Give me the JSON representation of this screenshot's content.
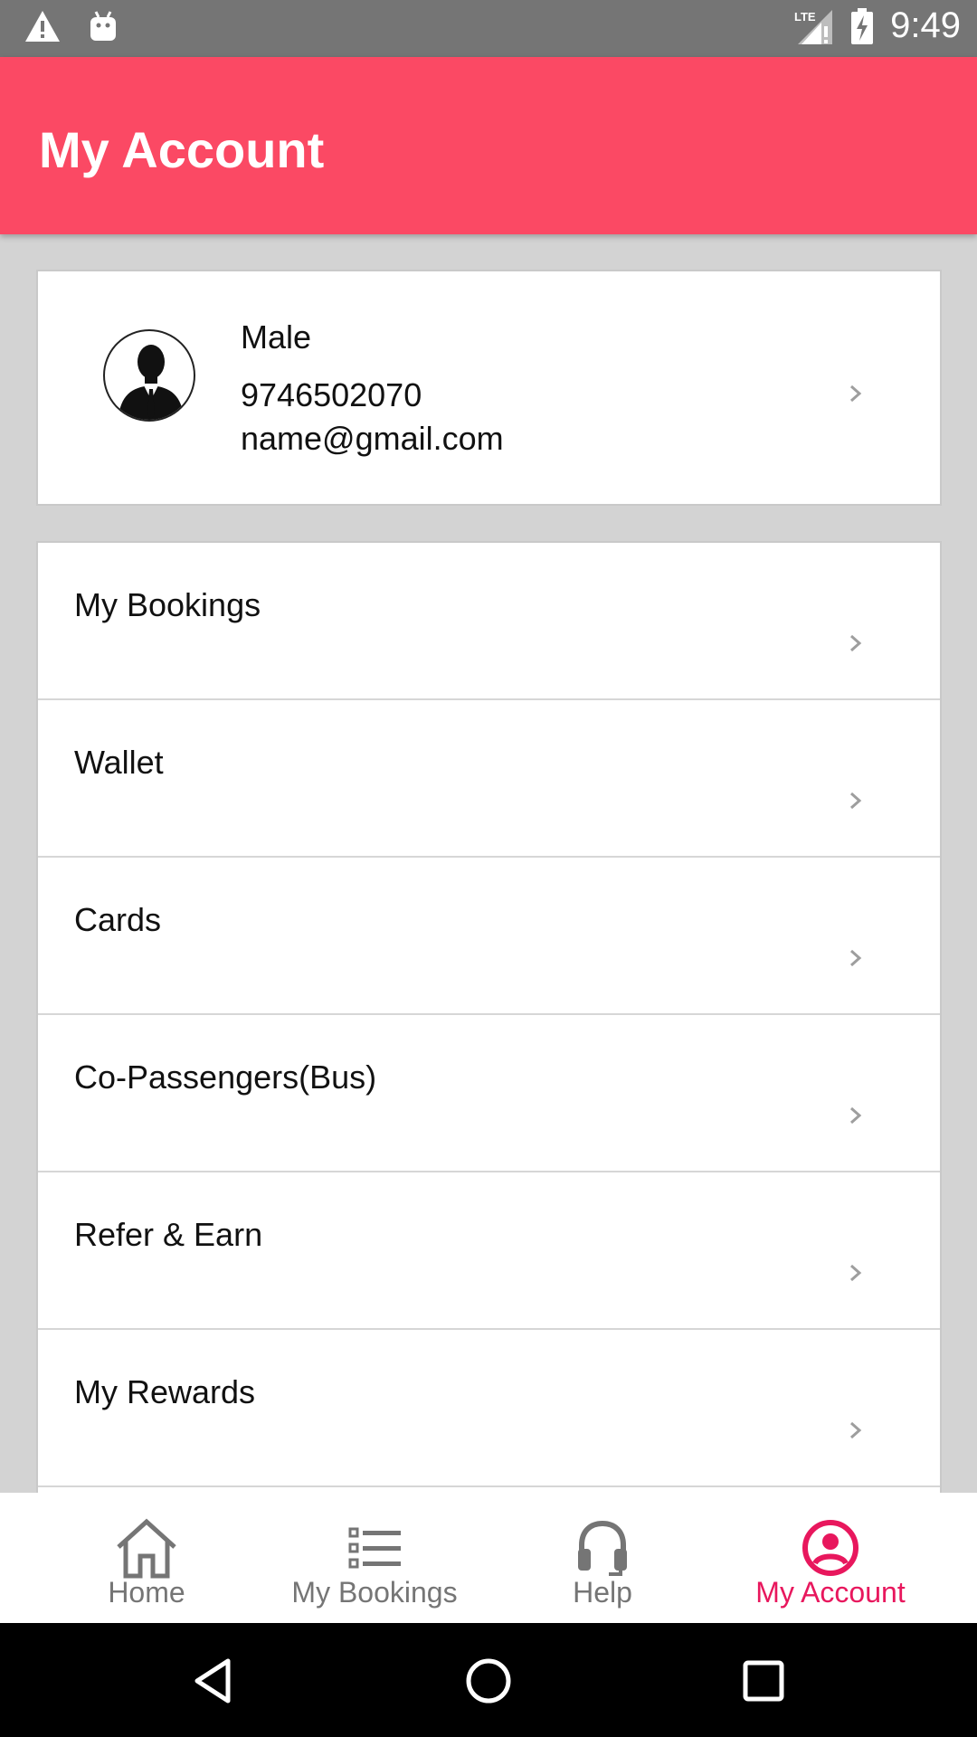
{
  "status_bar": {
    "time": "9:49",
    "icons": [
      "warning-icon",
      "android-icon",
      "lte-signal-icon",
      "battery-charging-icon"
    ]
  },
  "header": {
    "title": "My Account"
  },
  "profile": {
    "gender": "Male",
    "phone": "9746502070",
    "email": "name@gmail.com",
    "avatar_icon": "user-silhouette-icon"
  },
  "menu": {
    "items": [
      {
        "label": "My Bookings"
      },
      {
        "label": "Wallet"
      },
      {
        "label": "Cards"
      },
      {
        "label": "Co-Passengers(Bus)"
      },
      {
        "label": "Refer & Earn"
      },
      {
        "label": "My Rewards"
      }
    ]
  },
  "bottom_nav": {
    "items": [
      {
        "label": "Home",
        "icon": "home-icon"
      },
      {
        "label": "My Bookings",
        "icon": "list-icon"
      },
      {
        "label": "Help",
        "icon": "headset-icon"
      },
      {
        "label": "My Account",
        "icon": "account-circle-icon",
        "active": true
      }
    ],
    "active_color": "#e8175d",
    "inactive_color": "#757575"
  },
  "colors": {
    "app_bar": "#fb4964",
    "background": "#d3d3d3"
  },
  "system_nav": {
    "icons": [
      "back-icon",
      "home-circle-icon",
      "recents-icon"
    ]
  }
}
